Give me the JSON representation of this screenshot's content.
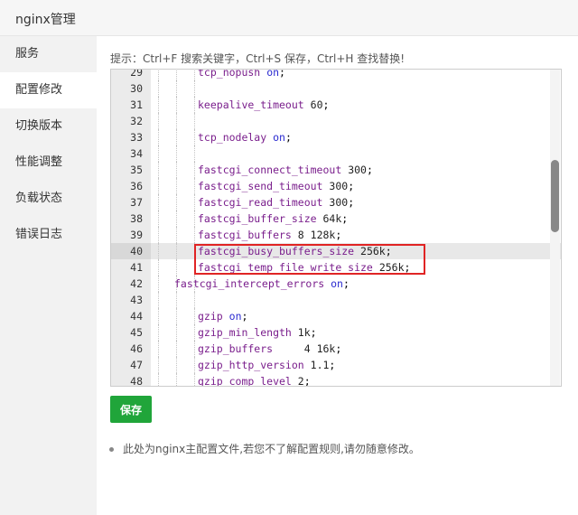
{
  "window": {
    "title": "nginx管理"
  },
  "sidebar": {
    "items": [
      {
        "label": "服务"
      },
      {
        "label": "配置修改"
      },
      {
        "label": "切换版本"
      },
      {
        "label": "性能调整"
      },
      {
        "label": "负载状态"
      },
      {
        "label": "错误日志"
      }
    ],
    "active_index": 1
  },
  "main": {
    "tip": "提示：Ctrl+F 搜索关键字，Ctrl+S 保存，Ctrl+H 查找替换!",
    "save_label": "保存",
    "note": "此处为nginx主配置文件,若您不了解配置规则,请勿随意修改。"
  },
  "editor": {
    "lines": [
      {
        "num": "29",
        "key": "tcp_nopush",
        "value": "on",
        "indent": 2
      },
      {
        "num": "30",
        "key": "",
        "value": "",
        "indent": 0
      },
      {
        "num": "31",
        "key": "keepalive_timeout",
        "value": "60",
        "indent": 2
      },
      {
        "num": "32",
        "key": "",
        "value": "",
        "indent": 0
      },
      {
        "num": "33",
        "key": "tcp_nodelay",
        "value": "on",
        "indent": 2
      },
      {
        "num": "34",
        "key": "",
        "value": "",
        "indent": 0
      },
      {
        "num": "35",
        "key": "fastcgi_connect_timeout",
        "value": "300",
        "indent": 2
      },
      {
        "num": "36",
        "key": "fastcgi_send_timeout",
        "value": "300",
        "indent": 2
      },
      {
        "num": "37",
        "key": "fastcgi_read_timeout",
        "value": "300",
        "indent": 2
      },
      {
        "num": "38",
        "key": "fastcgi_buffer_size",
        "value": "64k",
        "indent": 2
      },
      {
        "num": "39",
        "key": "fastcgi_buffers",
        "value": "8 128k",
        "indent": 2
      },
      {
        "num": "40",
        "key": "fastcgi_busy_buffers_size",
        "value": "256k",
        "indent": 2,
        "highlight": true
      },
      {
        "num": "41",
        "key": "fastcgi_temp_file_write_size",
        "value": "256k",
        "indent": 2
      },
      {
        "num": "42",
        "key": "fastcgi_intercept_errors",
        "value": "on",
        "indent": 1
      },
      {
        "num": "43",
        "key": "",
        "value": "",
        "indent": 0
      },
      {
        "num": "44",
        "key": "gzip",
        "value": "on",
        "indent": 2
      },
      {
        "num": "45",
        "key": "gzip_min_length",
        "value": "1k",
        "indent": 2
      },
      {
        "num": "46",
        "key": "gzip_buffers",
        "value": "    4 16k",
        "indent": 2
      },
      {
        "num": "47",
        "key": "gzip_http_version",
        "value": "1.1",
        "indent": 2
      },
      {
        "num": "48",
        "key": "gzip_comp_level",
        "value": "2",
        "indent": 2
      }
    ]
  },
  "colors": {
    "accent_green": "#20a53a",
    "annotation_red": "#e02424"
  }
}
